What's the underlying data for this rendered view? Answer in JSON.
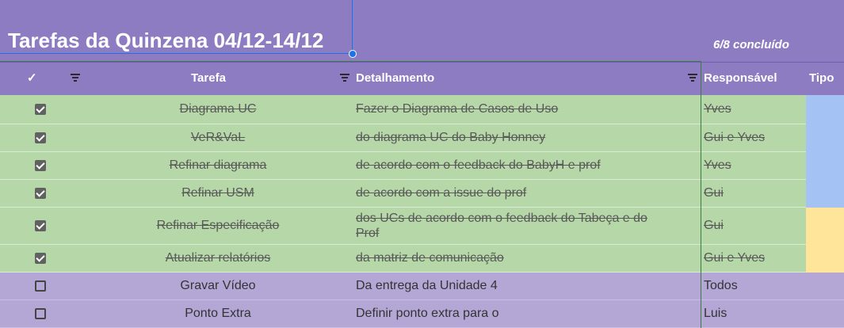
{
  "sheet": {
    "title": "Tarefas da Quinzena 04/12-14/12",
    "progress": "6/8 concluído"
  },
  "headers": {
    "check": "✓",
    "task": "Tarefa",
    "detail": "Detalhamento",
    "owner": "Responsável",
    "type": "Tipo"
  },
  "rows": [
    {
      "checked": true,
      "task": "Diagrama UC",
      "detail": "Fazer o Diagrama de Casos de Uso",
      "owner": "Yves",
      "type_color": "#a4c2f4"
    },
    {
      "checked": true,
      "task": "VeR&VaL",
      "detail": "do diagrama UC do Baby Honney",
      "owner": "Gui e Yves",
      "type_color": "#a4c2f4"
    },
    {
      "checked": true,
      "task": "Refinar diagrama",
      "detail": "de acordo com o feedback do BabyH e prof",
      "owner": "Yves",
      "type_color": "#a4c2f4"
    },
    {
      "checked": true,
      "task": "Refinar USM",
      "detail": "de acordo com a issue do prof",
      "owner": "Gui",
      "type_color": "#a4c2f4"
    },
    {
      "checked": true,
      "task": "Refinar Especificação",
      "detail_line1": "dos UCs de acordo com o feedback do Tabeça e do",
      "detail_line2": "Prof",
      "owner": "Gui",
      "type_color": "#ffe599"
    },
    {
      "checked": true,
      "task": "Atualizar relatórios",
      "detail": "da matriz de comunicação",
      "owner": "Gui e Yves",
      "type_color": "#ffe599"
    },
    {
      "checked": false,
      "task": "Gravar Vídeo",
      "detail": "Da entrega da Unidade 4",
      "owner": "Todos",
      "type_color": "#b4a7d6"
    },
    {
      "checked": false,
      "task": "Ponto Extra",
      "detail": "Definir ponto extra para o",
      "owner": "Luis",
      "type_color": "#b4a7d6"
    }
  ]
}
